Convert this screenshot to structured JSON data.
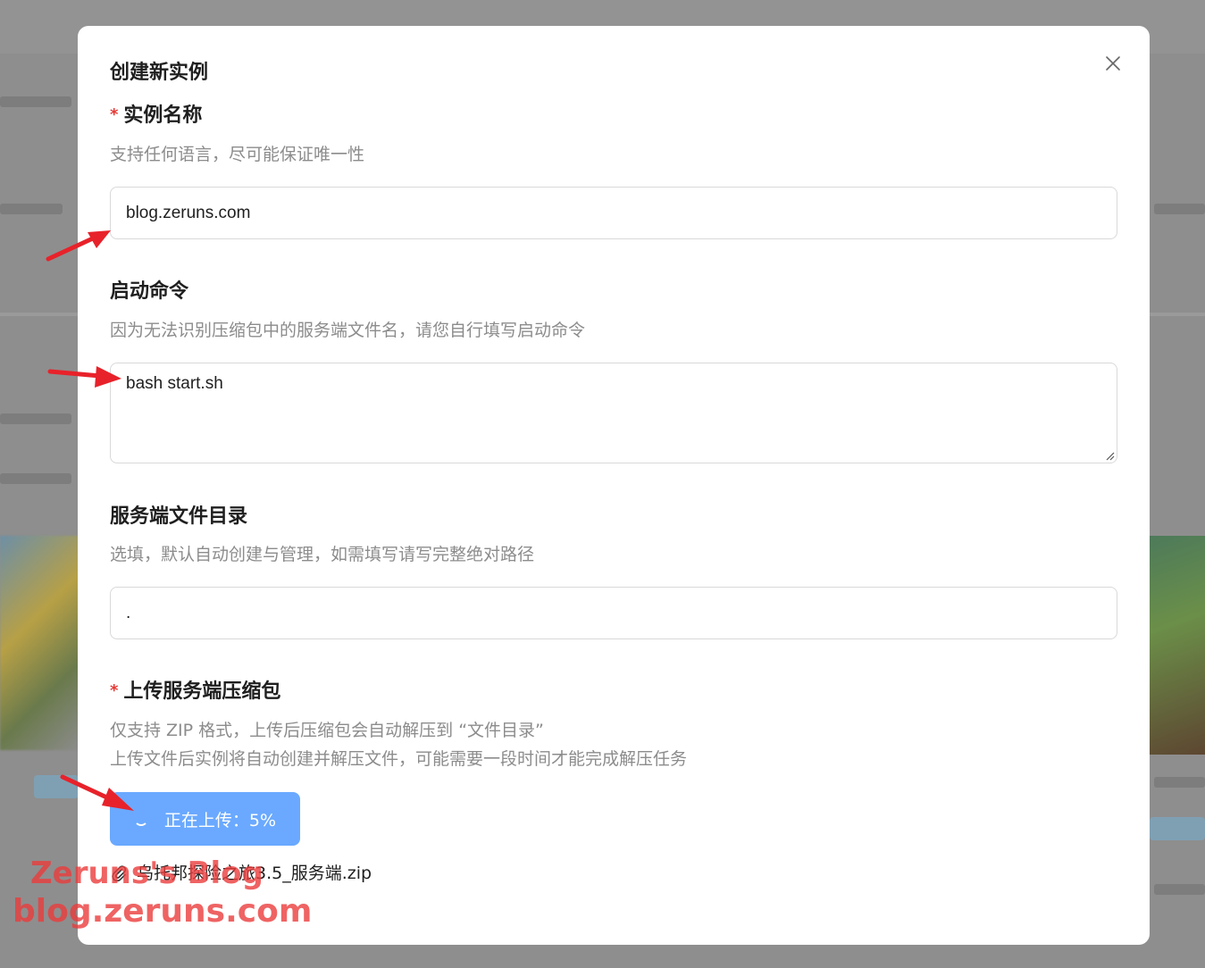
{
  "modal": {
    "title": "创建新实例",
    "close_icon": "close-icon"
  },
  "instance_name": {
    "label": "实例名称",
    "required_mark": "*",
    "hint": "支持任何语言，尽可能保证唯一性",
    "value": "blog.zeruns.com"
  },
  "start_command": {
    "label": "启动命令",
    "hint": "因为无法识别压缩包中的服务端文件名，请您自行填写启动命令",
    "value": "bash start.sh"
  },
  "server_dir": {
    "label": "服务端文件目录",
    "hint": "选填，默认自动创建与管理，如需填写请写完整绝对路径",
    "value": "."
  },
  "upload": {
    "label": "上传服务端压缩包",
    "required_mark": "*",
    "hint_line1": "仅支持 ZIP 格式，上传后压缩包会自动解压到 “文件目录”",
    "hint_line2": "上传文件后实例将自动创建并解压文件，可能需要一段时间才能完成解压任务",
    "button_label": "正在上传：5%",
    "progress_percent": 5,
    "file_icon": "paperclip-icon",
    "file_name": "乌托邦探险之旅3.5_服务端.zip"
  },
  "watermark": {
    "line1": "Zeruns's Blog",
    "line2": "blog.zeruns.com"
  },
  "colors": {
    "primary": "#6aa9ff",
    "required": "#e53935",
    "annotation_arrow": "#e8222a"
  }
}
